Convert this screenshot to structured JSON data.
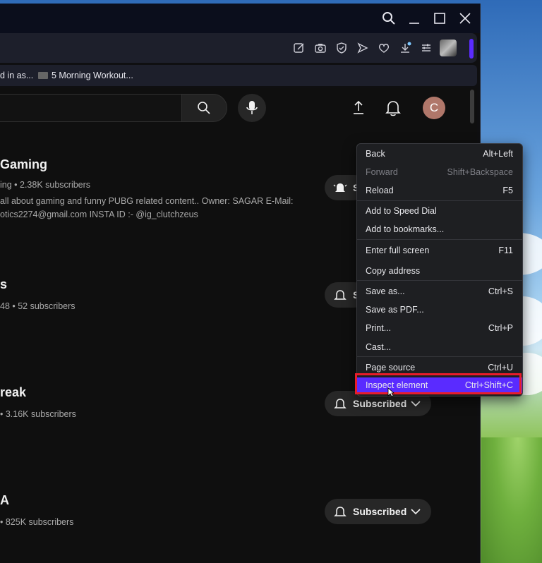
{
  "bookmarks": {
    "item1": "d in as...",
    "item2": "5 Morning Workout..."
  },
  "account": {
    "initial": "C"
  },
  "channels": [
    {
      "name": "Gaming",
      "meta": "ing • 2.38K subscribers",
      "desc_line1": "all about gaming and funny PUBG related content.. Owner: SAGAR E-Mail:",
      "desc_line2": "otics2274@gmail.com INSTA ID :- @ig_clutchzeus",
      "button": "S"
    },
    {
      "name": "s",
      "meta": "48 • 52 subscribers",
      "button": "S"
    },
    {
      "name": "reak",
      "meta": "• 3.16K subscribers",
      "button": "Subscribed"
    },
    {
      "name": "A",
      "meta": "• 825K subscribers",
      "button": "Subscribed"
    }
  ],
  "context_menu": {
    "items": [
      {
        "label": "Back",
        "shortcut": "Alt+Left"
      },
      {
        "label": "Forward",
        "shortcut": "Shift+Backspace"
      },
      {
        "label": "Reload",
        "shortcut": "F5"
      },
      {
        "label": "Add to Speed Dial",
        "shortcut": ""
      },
      {
        "label": "Add to bookmarks...",
        "shortcut": ""
      },
      {
        "label": "Enter full screen",
        "shortcut": "F11"
      },
      {
        "label": "Copy address",
        "shortcut": ""
      },
      {
        "label": "Save as...",
        "shortcut": "Ctrl+S"
      },
      {
        "label": "Save as PDF...",
        "shortcut": ""
      },
      {
        "label": "Print...",
        "shortcut": "Ctrl+P"
      },
      {
        "label": "Cast...",
        "shortcut": ""
      },
      {
        "label": "Page source",
        "shortcut": "Ctrl+U"
      },
      {
        "label": "Inspect element",
        "shortcut": "Ctrl+Shift+C"
      }
    ]
  },
  "colors": {
    "menu_highlight": "#5a2bff",
    "annotation_box": "#e81c2a",
    "page_bg": "#0f0f0f"
  }
}
